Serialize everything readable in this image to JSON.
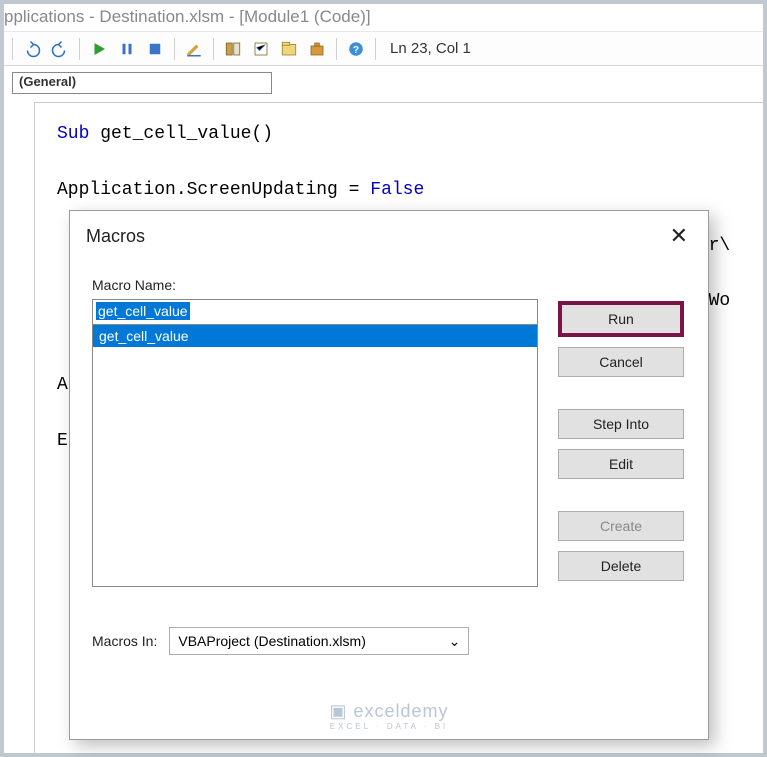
{
  "titlebar": "pplications - Destination.xlsm - [Module1 (Code)]",
  "cursor_status": "Ln 23, Col 1",
  "object_dropdown": "(General)",
  "code_lines": {
    "l1a": "Sub",
    "l1b": " get_cell_value()",
    "l2": "",
    "l3a": "Application.ScreenUpdating = ",
    "l3b": "False",
    "l4": "",
    "l5tail": "ser\\",
    "l6": "",
    "l7tail": "isWo",
    "l8": "",
    "l9": "",
    "l10": "Ap",
    "l11": "",
    "l12": "En"
  },
  "dialog": {
    "title": "Macros",
    "close": "✕",
    "name_label": "Macro Name:",
    "name_value": "get_cell_value",
    "list_item": "get_cell_value",
    "btn_run": "Run",
    "btn_cancel": "Cancel",
    "btn_step": "Step Into",
    "btn_edit": "Edit",
    "btn_create": "Create",
    "btn_delete": "Delete",
    "macros_in_label": "Macros In:",
    "macros_in_value": "VBAProject (Destination.xlsm)"
  },
  "watermark": {
    "main": "exceldemy",
    "sub": "EXCEL · DATA · BI"
  }
}
